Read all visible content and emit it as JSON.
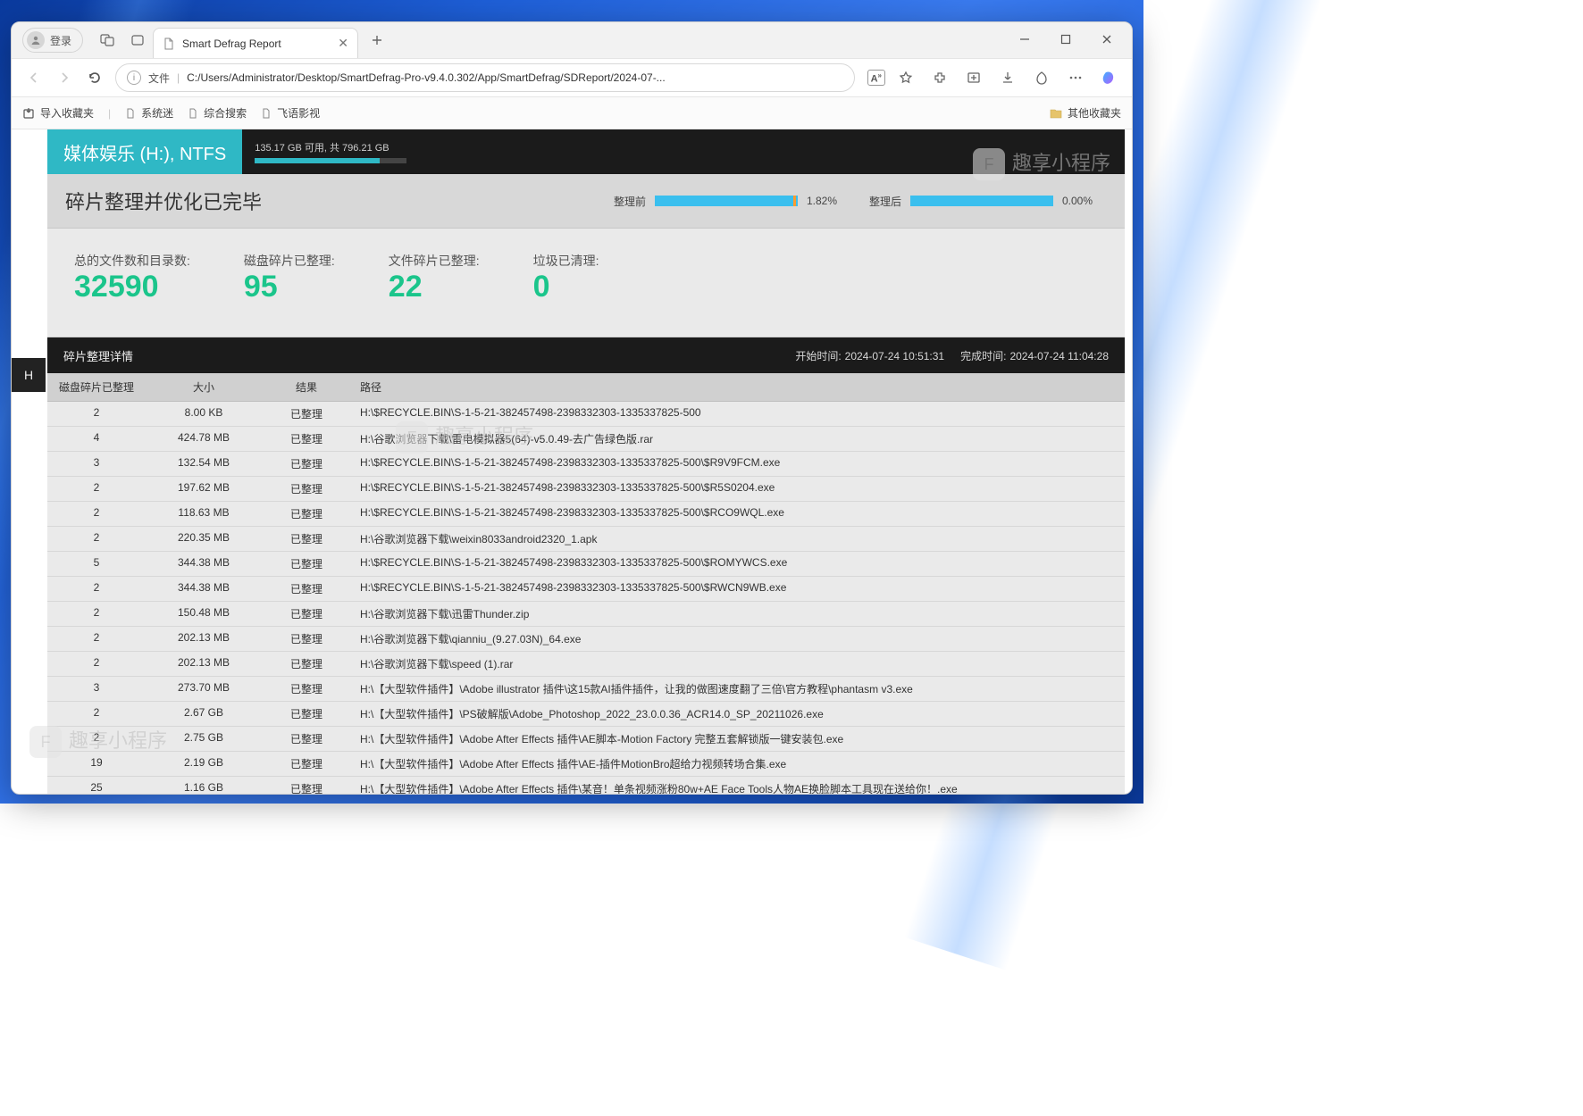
{
  "titlebar": {
    "login_label": "登录",
    "tab_title": "Smart Defrag Report",
    "add_tab_icon": "plus-icon"
  },
  "window_controls": {
    "min": "–",
    "max": "▢",
    "close": "✕"
  },
  "address": {
    "file_label": "文件",
    "url": "C:/Users/Administrator/Desktop/SmartDefrag-Pro-v9.4.0.302/App/SmartDefrag/SDReport/2024-07-...",
    "aa_label": "A"
  },
  "bookmarks": {
    "import_label": "导入收藏夹",
    "items": [
      "系统迷",
      "综合搜索",
      "飞语影视"
    ],
    "other_label": "其他收藏夹"
  },
  "report": {
    "drive_name": "媒体娱乐 (H:), NTFS",
    "usage_text": "135.17 GB 可用, 共 796.21 GB",
    "usage_fill_pct": 82,
    "status_title": "碎片整理并优化已完毕",
    "before_label": "整理前",
    "before_pct": "1.82%",
    "after_label": "整理后",
    "after_pct": "0.00%",
    "side_tab": "H",
    "stats": {
      "total_label": "总的文件数和目录数:",
      "total": "32590",
      "disk_label": "磁盘碎片已整理:",
      "disk": "95",
      "file_label": "文件碎片已整理:",
      "file": "22",
      "junk_label": "垃圾已清理:",
      "junk": "0"
    },
    "details_title": "碎片整理详情",
    "start_label": "开始时间:",
    "start_time": "2024-07-24 10:51:31",
    "end_label": "完成时间:",
    "end_time": "2024-07-24 11:04:28",
    "columns": {
      "frag": "磁盘碎片已整理",
      "size": "大小",
      "result": "结果",
      "path": "路径"
    },
    "rows": [
      {
        "frag": "2",
        "size": "8.00 KB",
        "result": "已整理",
        "path": "H:\\$RECYCLE.BIN\\S-1-5-21-382457498-2398332303-1335337825-500"
      },
      {
        "frag": "4",
        "size": "424.78 MB",
        "result": "已整理",
        "path": "H:\\谷歌浏览器下载\\雷电模拟器5(64)-v5.0.49-去广告绿色版.rar"
      },
      {
        "frag": "3",
        "size": "132.54 MB",
        "result": "已整理",
        "path": "H:\\$RECYCLE.BIN\\S-1-5-21-382457498-2398332303-1335337825-500\\$R9V9FCM.exe"
      },
      {
        "frag": "2",
        "size": "197.62 MB",
        "result": "已整理",
        "path": "H:\\$RECYCLE.BIN\\S-1-5-21-382457498-2398332303-1335337825-500\\$R5S0204.exe"
      },
      {
        "frag": "2",
        "size": "118.63 MB",
        "result": "已整理",
        "path": "H:\\$RECYCLE.BIN\\S-1-5-21-382457498-2398332303-1335337825-500\\$RCO9WQL.exe"
      },
      {
        "frag": "2",
        "size": "220.35 MB",
        "result": "已整理",
        "path": "H:\\谷歌浏览器下载\\weixin8033android2320_1.apk"
      },
      {
        "frag": "5",
        "size": "344.38 MB",
        "result": "已整理",
        "path": "H:\\$RECYCLE.BIN\\S-1-5-21-382457498-2398332303-1335337825-500\\$ROMYWCS.exe"
      },
      {
        "frag": "2",
        "size": "344.38 MB",
        "result": "已整理",
        "path": "H:\\$RECYCLE.BIN\\S-1-5-21-382457498-2398332303-1335337825-500\\$RWCN9WB.exe"
      },
      {
        "frag": "2",
        "size": "150.48 MB",
        "result": "已整理",
        "path": "H:\\谷歌浏览器下载\\迅雷Thunder.zip"
      },
      {
        "frag": "2",
        "size": "202.13 MB",
        "result": "已整理",
        "path": "H:\\谷歌浏览器下载\\qianniu_(9.27.03N)_64.exe"
      },
      {
        "frag": "2",
        "size": "202.13 MB",
        "result": "已整理",
        "path": "H:\\谷歌浏览器下载\\speed (1).rar"
      },
      {
        "frag": "3",
        "size": "273.70 MB",
        "result": "已整理",
        "path": "H:\\【大型软件插件】\\Adobe illustrator 插件\\这15款AI插件插件，让我的做图速度翻了三倍\\官方教程\\phantasm v3.exe"
      },
      {
        "frag": "2",
        "size": "2.67 GB",
        "result": "已整理",
        "path": "H:\\【大型软件插件】\\PS破解版\\Adobe_Photoshop_2022_23.0.0.36_ACR14.0_SP_20211026.exe"
      },
      {
        "frag": "2",
        "size": "2.75 GB",
        "result": "已整理",
        "path": "H:\\【大型软件插件】\\Adobe After Effects 插件\\AE脚本-Motion Factory 完整五套解锁版一键安装包.exe"
      },
      {
        "frag": "19",
        "size": "2.19 GB",
        "result": "已整理",
        "path": "H:\\【大型软件插件】\\Adobe After Effects 插件\\AE-插件MotionBro超给力视频转场合集.exe"
      },
      {
        "frag": "25",
        "size": "1.16 GB",
        "result": "已整理",
        "path": "H:\\【大型软件插件】\\Adobe After Effects 插件\\某音！单条视频涨粉80w+AE Face Tools人物AE换脸脚本工具现在送给你！.exe"
      }
    ]
  },
  "watermark_text": "趣享小程序"
}
